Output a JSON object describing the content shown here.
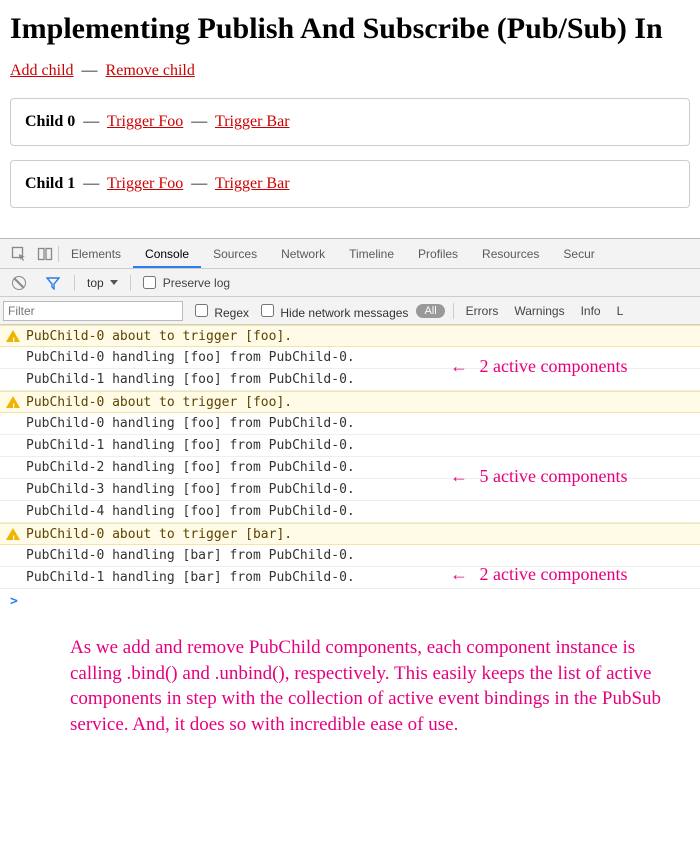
{
  "page": {
    "title": "Implementing Publish And Subscribe (Pub/Sub) In",
    "top_links": {
      "add": "Add child",
      "remove": "Remove child"
    },
    "sep": "—",
    "children": [
      {
        "label": "Child 0",
        "foo": "Trigger Foo",
        "bar": "Trigger Bar"
      },
      {
        "label": "Child 1",
        "foo": "Trigger Foo",
        "bar": "Trigger Bar"
      }
    ]
  },
  "devtools": {
    "tabs": [
      "Elements",
      "Console",
      "Sources",
      "Network",
      "Timeline",
      "Profiles",
      "Resources",
      "Secur"
    ],
    "active_tab": "Console",
    "toolbar": {
      "context": "top",
      "preserve_log_label": "Preserve log"
    },
    "filterbar": {
      "placeholder": "Filter",
      "regex_label": "Regex",
      "hide_net_label": "Hide network messages",
      "all_pill": "All",
      "levels": [
        "Errors",
        "Warnings",
        "Info",
        "L"
      ]
    },
    "console_rows": [
      {
        "type": "warn",
        "text": "PubChild-0 about to trigger [foo]."
      },
      {
        "type": "log",
        "text": "PubChild-0 handling [foo] from PubChild-0."
      },
      {
        "type": "log",
        "text": "PubChild-1 handling [foo] from PubChild-0."
      },
      {
        "type": "warn",
        "text": "PubChild-0 about to trigger [foo]."
      },
      {
        "type": "log",
        "text": "PubChild-0 handling [foo] from PubChild-0."
      },
      {
        "type": "log",
        "text": "PubChild-1 handling [foo] from PubChild-0."
      },
      {
        "type": "log",
        "text": "PubChild-2 handling [foo] from PubChild-0."
      },
      {
        "type": "log",
        "text": "PubChild-3 handling [foo] from PubChild-0."
      },
      {
        "type": "log",
        "text": "PubChild-4 handling [foo] from PubChild-0."
      },
      {
        "type": "warn",
        "text": "PubChild-0 about to trigger [bar]."
      },
      {
        "type": "log",
        "text": "PubChild-0 handling [bar] from PubChild-0."
      },
      {
        "type": "log",
        "text": "PubChild-1 handling [bar] from PubChild-0."
      }
    ],
    "prompt": ">"
  },
  "annotations": {
    "a1": "2 active components",
    "a2": "5 active components",
    "a3": "2 active components",
    "arrow": "←",
    "paragraph": "As we add and remove PubChild components, each component instance is calling .bind() and .unbind(), respectively. This easily keeps the list of active components in step with the collection of active event bindings in the PubSub service. And, it does so with incredible ease of use."
  }
}
